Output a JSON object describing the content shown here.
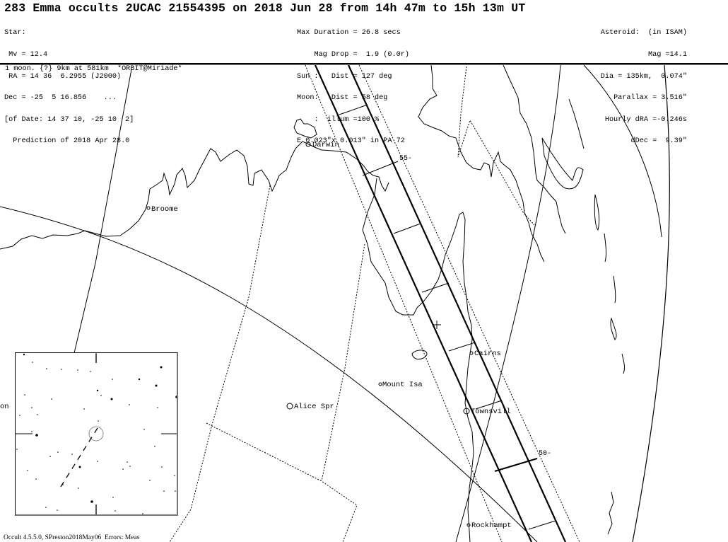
{
  "header": {
    "title": "283 Emma occults 2UCAC 21554395 on 2018 Jun 28 from 14h 47m to 15h 13m UT",
    "star": {
      "label": "Star:",
      "mv": " Mv = 12.4",
      "ra": " RA = 14 36  6.2955 (J2000)",
      "dec": "Dec = -25  5 16.856    ...",
      "of_date": "[of Date: 14 37 10, -25 10  2]",
      "prediction": "  Prediction of 2018 Apr 28.0"
    },
    "event": {
      "max_duration": "Max Duration = 26.8 secs",
      "mag_drop": "    Mag Drop =  1.9 (0.0r)",
      "sun": "Sun :   Dist = 127 deg",
      "moon": "Moon:   Dist = 58 deg",
      "illum": "    :  illum =100 %",
      "error_ellipse": "E 0.023\"x 0.013\" in PA 72"
    },
    "asteroid": {
      "label": "Asteroid:  (in ISAM)",
      "mag": "Mag =14.1",
      "dia": "Dia = 135km,  0.074\"",
      "parallax": "Parallax = 3.516\"",
      "hourly_dra": "Hourly dRA =-0.246s",
      "ddec": "dDec =  9.39\""
    }
  },
  "moon_note": "1 moon. {?} 9km at 581km  *ORBIT@Miriade*",
  "map": {
    "cities": [
      {
        "name": "Darwin"
      },
      {
        "name": "Broome"
      },
      {
        "name": "Alice Spr"
      },
      {
        "name": "Mount Isa"
      },
      {
        "name": "Cairns"
      },
      {
        "name": "Townsvill"
      },
      {
        "name": "Rockhampt"
      },
      {
        "name": "on"
      }
    ],
    "path_time_labels": [
      "55-",
      "50-"
    ],
    "path_colors": {
      "line": "#000000",
      "background": "#ffffff",
      "inset_border": "#777777"
    }
  },
  "footer": "Occult 4.5.5.0, SPreston2018May06  Errors: Meas"
}
